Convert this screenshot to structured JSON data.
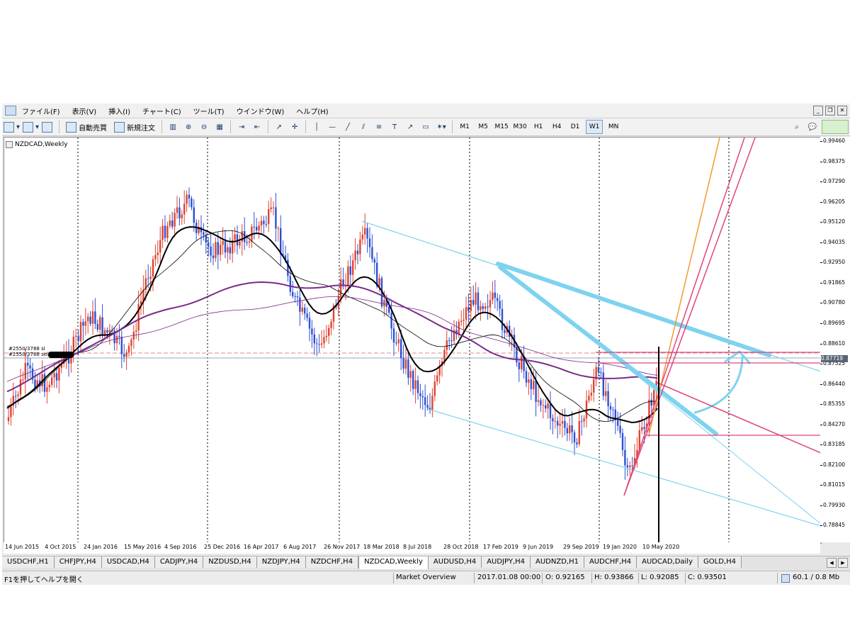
{
  "menu": [
    "ファイル(F)",
    "表示(V)",
    "挿入(I)",
    "チャート(C)",
    "ツール(T)",
    "ウインドウ(W)",
    "ヘルプ(H)"
  ],
  "toolbar": {
    "auto_trade": "自動売買",
    "new_order": "新規注文",
    "timeframes": [
      "M1",
      "M5",
      "M15",
      "M30",
      "H1",
      "H4",
      "D1",
      "W1",
      "MN"
    ],
    "active_timeframe": "W1"
  },
  "chart": {
    "symbol_label": "NZDCAD,Weekly",
    "order_label_1": "#2550/3788 sl",
    "order_label_2": "#2550/3788 sell",
    "price_axis": [
      "0.99460",
      "0.98375",
      "0.97290",
      "0.96205",
      "0.95120",
      "0.94035",
      "0.92950",
      "0.91865",
      "0.90780",
      "0.89695",
      "0.88610",
      "0.87525",
      "0.86440",
      "0.85355",
      "0.84270",
      "0.83185",
      "0.82100",
      "0.81015",
      "0.79930",
      "0.78845"
    ],
    "current_price": "0.87719",
    "time_axis": [
      "14 Jun 2015",
      "4 Oct 2015",
      "24 Jan 2016",
      "15 May 2016",
      "4 Sep 2016",
      "25 Dec 2016",
      "16 Apr 2017",
      "6 Aug 2017",
      "26 Nov 2017",
      "18 Mar 2018",
      "8 Jul 2018",
      "28 Oct 2018",
      "17 Feb 2019",
      "9 Jun 2019",
      "29 Sep 2019",
      "19 Jan 2020",
      "10 May 2020"
    ],
    "colors": {
      "bull": "#e0432f",
      "bear": "#2c4fd6",
      "ma_fast": "#000000",
      "ma_slow": "#7a2a8a",
      "trend_cyan": "#7ed3ef",
      "fan_pink": "#e0457e",
      "fan_orange": "#f29a2e"
    }
  },
  "tabs": [
    "USDCHF,H1",
    "CHFJPY,H4",
    "USDCAD,H4",
    "CADJPY,H4",
    "NZDUSD,H4",
    "NZDJPY,H4",
    "NZDCHF,H4",
    "NZDCAD,Weekly",
    "AUDUSD,H4",
    "AUDJPY,H4",
    "AUDNZD,H1",
    "AUDCHF,H4",
    "AUDCAD,Daily",
    "GOLD,H4"
  ],
  "active_tab": "NZDCAD,Weekly",
  "status": {
    "help": "F1を押してヘルプを開く",
    "profile": "Market Overview",
    "datetime": "2017.01.08 00:00",
    "open": "O: 0.92165",
    "high": "H: 0.93866",
    "low": "L: 0.92085",
    "close": "C: 0.93501",
    "traffic": "60.1 / 0.8 Mb"
  }
}
